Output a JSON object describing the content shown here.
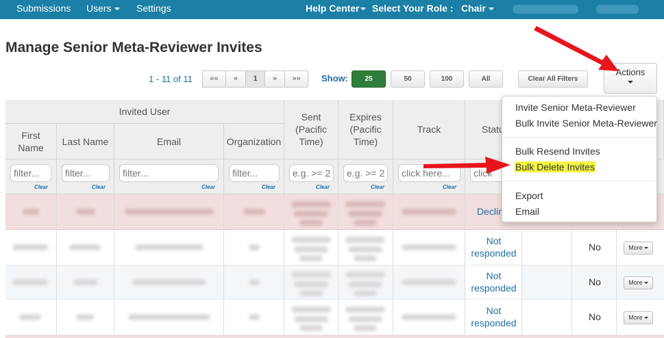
{
  "topnav": {
    "submissions": "Submissions",
    "users": "Users",
    "settings": "Settings",
    "help_center": "Help Center",
    "select_role": "Select Your Role :",
    "role": "Chair"
  },
  "page": {
    "title": "Manage Senior Meta-Reviewer Invites"
  },
  "pager": {
    "info": "1 - 11 of 11",
    "first": "««",
    "prev": "«",
    "current": "1",
    "next": "»",
    "last": "»»"
  },
  "show": {
    "label": "Show:",
    "options": [
      "25",
      "50",
      "100",
      "All"
    ],
    "selected": "25"
  },
  "clear_filters": "Clear All Filters",
  "actions": {
    "label": "Actions"
  },
  "table": {
    "group_header": "Invited User",
    "columns": {
      "first_name": "First Name",
      "last_name": "Last Name",
      "email": "Email",
      "organization": "Organization",
      "sent": "Sent (Pacific Time)",
      "expires": "Expires (Pacific Time)",
      "track": "Track",
      "status": "Status"
    },
    "filters": {
      "first_name": "filter...",
      "last_name": "filter...",
      "email": "filter...",
      "organization": "filter...",
      "sent": "e.g. >= 2",
      "expires": "e.g. >= 2",
      "track": "click here...",
      "status": "click",
      "clear": "Clear"
    },
    "rows": [
      {
        "status": "Declin",
        "responded": "",
        "more": ""
      },
      {
        "status": "Not responded",
        "responded": "No",
        "more": "More"
      },
      {
        "status": "Not responded",
        "responded": "No",
        "more": "More"
      },
      {
        "status": "Not responded",
        "responded": "No",
        "more": "More"
      }
    ]
  },
  "menu": {
    "items": [
      "Invite Senior Meta-Reviewer",
      "Bulk Invite Senior Meta-Reviewer",
      "Bulk Resend Invites",
      "Bulk Delete Invites",
      "Export",
      "Email"
    ]
  },
  "colors": {
    "nav": "#1b7fa6",
    "link": "#1d6fa5",
    "selected_show": "#2f7d3a",
    "declined_row": "#f2dede",
    "highlight": "#f5f542",
    "arrow": "#e8141c"
  }
}
